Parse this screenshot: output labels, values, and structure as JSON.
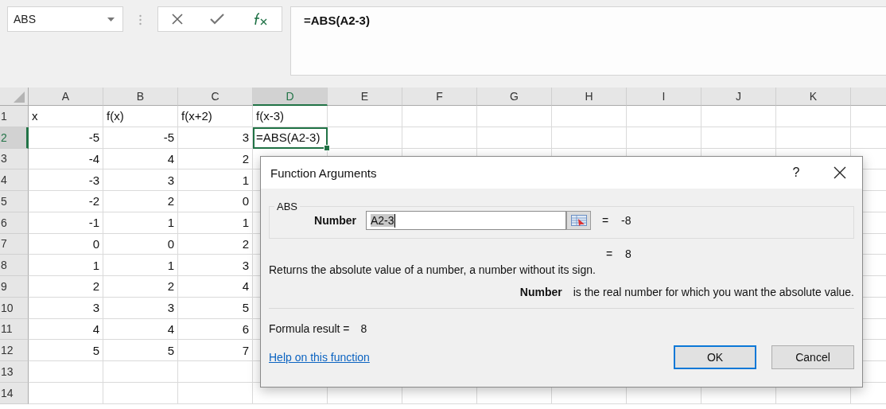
{
  "name_box": {
    "value": "ABS"
  },
  "formula_bar": {
    "value": "=ABS(A2-3)"
  },
  "sheet": {
    "columns": [
      {
        "label": "A",
        "selected": false
      },
      {
        "label": "B",
        "selected": false
      },
      {
        "label": "C",
        "selected": false
      },
      {
        "label": "D",
        "selected": true
      },
      {
        "label": "E",
        "selected": false
      },
      {
        "label": "F",
        "selected": false
      },
      {
        "label": "G",
        "selected": false
      },
      {
        "label": "H",
        "selected": false
      },
      {
        "label": "I",
        "selected": false
      },
      {
        "label": "J",
        "selected": false
      },
      {
        "label": "K",
        "selected": false
      }
    ],
    "rows": [
      {
        "label": "1",
        "selected": false,
        "cells": [
          {
            "text": "x",
            "kind": "text"
          },
          {
            "text": "f(x)",
            "kind": "text"
          },
          {
            "text": "f(x+2)",
            "kind": "text"
          },
          {
            "text": "f(x-3)",
            "kind": "text"
          }
        ]
      },
      {
        "label": "2",
        "selected": true,
        "cells": [
          {
            "text": "-5",
            "kind": "number"
          },
          {
            "text": "-5",
            "kind": "number"
          },
          {
            "text": "3",
            "kind": "number"
          },
          {
            "text": "=ABS(A2-3)",
            "kind": "text"
          }
        ]
      },
      {
        "label": "3",
        "selected": false,
        "cells": [
          {
            "text": "-4",
            "kind": "number"
          },
          {
            "text": "4",
            "kind": "number"
          },
          {
            "text": "2",
            "kind": "number"
          }
        ]
      },
      {
        "label": "4",
        "selected": false,
        "cells": [
          {
            "text": "-3",
            "kind": "number"
          },
          {
            "text": "3",
            "kind": "number"
          },
          {
            "text": "1",
            "kind": "number"
          }
        ]
      },
      {
        "label": "5",
        "selected": false,
        "cells": [
          {
            "text": "-2",
            "kind": "number"
          },
          {
            "text": "2",
            "kind": "number"
          },
          {
            "text": "0",
            "kind": "number"
          }
        ]
      },
      {
        "label": "6",
        "selected": false,
        "cells": [
          {
            "text": "-1",
            "kind": "number"
          },
          {
            "text": "1",
            "kind": "number"
          },
          {
            "text": "1",
            "kind": "number"
          }
        ]
      },
      {
        "label": "7",
        "selected": false,
        "cells": [
          {
            "text": "0",
            "kind": "number"
          },
          {
            "text": "0",
            "kind": "number"
          },
          {
            "text": "2",
            "kind": "number"
          }
        ]
      },
      {
        "label": "8",
        "selected": false,
        "cells": [
          {
            "text": "1",
            "kind": "number"
          },
          {
            "text": "1",
            "kind": "number"
          },
          {
            "text": "3",
            "kind": "number"
          }
        ]
      },
      {
        "label": "9",
        "selected": false,
        "cells": [
          {
            "text": "2",
            "kind": "number"
          },
          {
            "text": "2",
            "kind": "number"
          },
          {
            "text": "4",
            "kind": "number"
          }
        ]
      },
      {
        "label": "10",
        "selected": false,
        "cells": [
          {
            "text": "3",
            "kind": "number"
          },
          {
            "text": "3",
            "kind": "number"
          },
          {
            "text": "5",
            "kind": "number"
          }
        ]
      },
      {
        "label": "11",
        "selected": false,
        "cells": [
          {
            "text": "4",
            "kind": "number"
          },
          {
            "text": "4",
            "kind": "number"
          },
          {
            "text": "6",
            "kind": "number"
          }
        ]
      },
      {
        "label": "12",
        "selected": false,
        "cells": [
          {
            "text": "5",
            "kind": "number"
          },
          {
            "text": "5",
            "kind": "number"
          },
          {
            "text": "7",
            "kind": "number"
          }
        ]
      },
      {
        "label": "13",
        "selected": false,
        "cells": []
      },
      {
        "label": "14",
        "selected": false,
        "cells": []
      }
    ]
  },
  "dialog": {
    "title": "Function Arguments",
    "help_button": "?",
    "function_name": "ABS",
    "arguments": [
      {
        "label": "Number",
        "value": "A2-3",
        "text_selected": true,
        "equals": "=",
        "result": "-8"
      }
    ],
    "function_result": {
      "equals": "=",
      "value": "8"
    },
    "description": "Returns the absolute value of a number, a number without its sign.",
    "argument_help": {
      "name": "Number",
      "text": "is the real number for which you want the absolute value."
    },
    "formula_result": {
      "label": "Formula result =",
      "value": "8"
    },
    "help_link": "Help on this function",
    "buttons": [
      {
        "label": "OK",
        "default": true
      },
      {
        "label": "Cancel",
        "default": false
      }
    ]
  }
}
